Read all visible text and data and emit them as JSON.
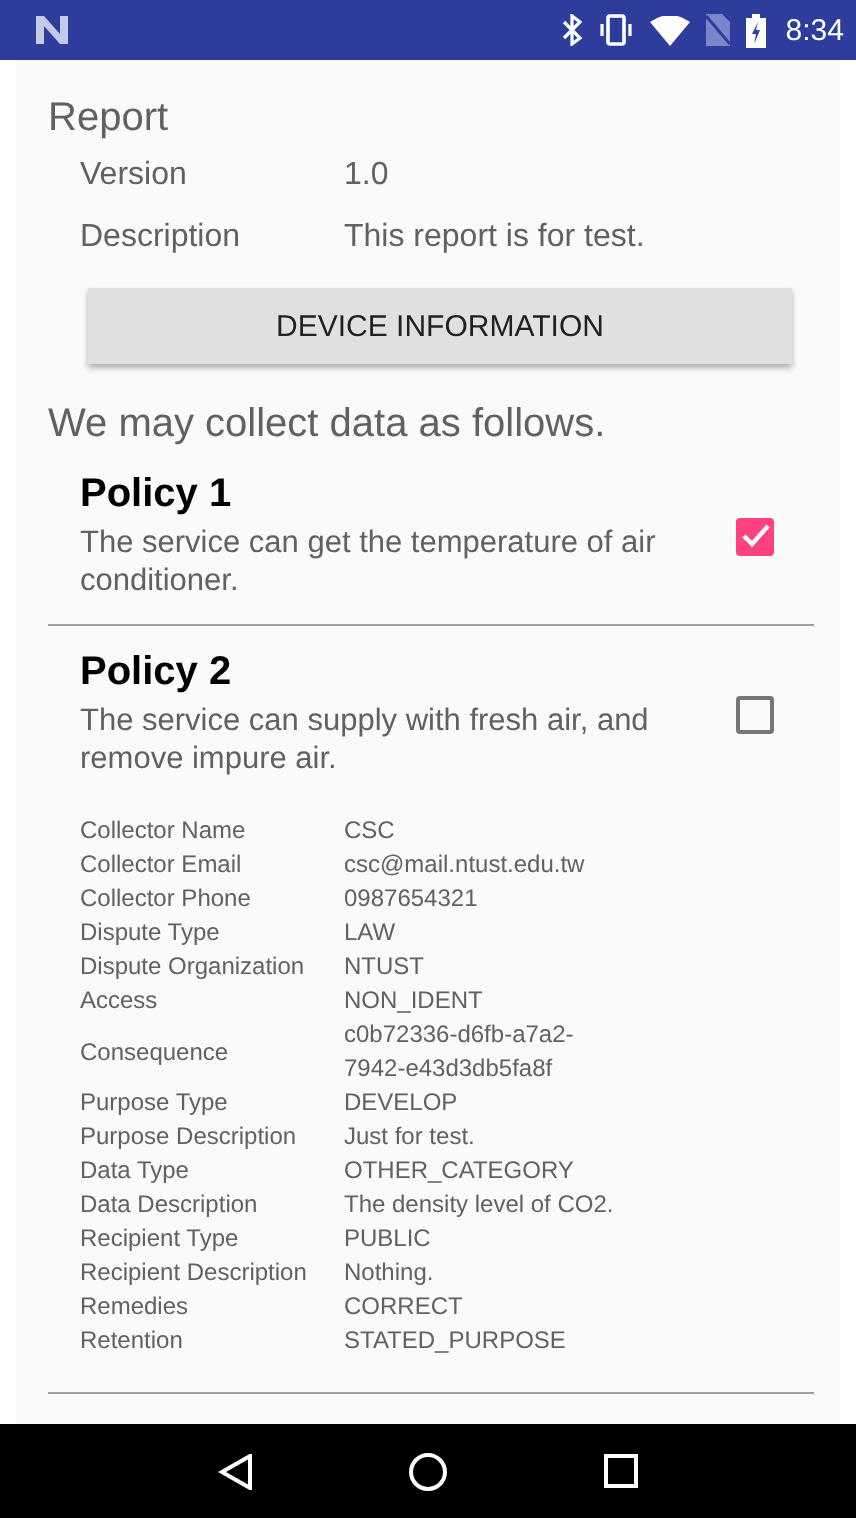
{
  "status_bar": {
    "time": "8:34"
  },
  "report": {
    "title": "Report",
    "fields": [
      {
        "label": "Version",
        "value": "1.0"
      },
      {
        "label": "Description",
        "value": "This report is for test."
      }
    ]
  },
  "device_button": "DEVICE INFORMATION",
  "intro": "We may collect data as follows.",
  "policies": [
    {
      "title": "Policy 1",
      "description": "The service can get the temperature of air conditioner.",
      "checked": true
    },
    {
      "title": "Policy 2",
      "description": "The service can supply with fresh air, and remove impure air.",
      "checked": false,
      "details": [
        {
          "label": "Collector Name",
          "value": "CSC"
        },
        {
          "label": "Collector Email",
          "value": "csc@mail.ntust.edu.tw"
        },
        {
          "label": "Collector Phone",
          "value": "0987654321"
        },
        {
          "label": "Dispute Type",
          "value": "LAW"
        },
        {
          "label": "Dispute Organization",
          "value": "NTUST"
        },
        {
          "label": "Access",
          "value": "NON_IDENT"
        },
        {
          "label": "Consequence",
          "value": "c0b72336-d6fb-a7a2-7942-e43d3db5fa8f"
        },
        {
          "label": "Purpose Type",
          "value": "DEVELOP"
        },
        {
          "label": "Purpose Description",
          "value": "Just for test."
        },
        {
          "label": "Data Type",
          "value": "OTHER_CATEGORY"
        },
        {
          "label": "Data Description",
          "value": "The density level of CO2."
        },
        {
          "label": "Recipient Type",
          "value": "PUBLIC"
        },
        {
          "label": "Recipient Description",
          "value": "Nothing."
        },
        {
          "label": "Remedies",
          "value": "CORRECT"
        },
        {
          "label": "Retention",
          "value": "STATED_PURPOSE"
        }
      ]
    }
  ]
}
